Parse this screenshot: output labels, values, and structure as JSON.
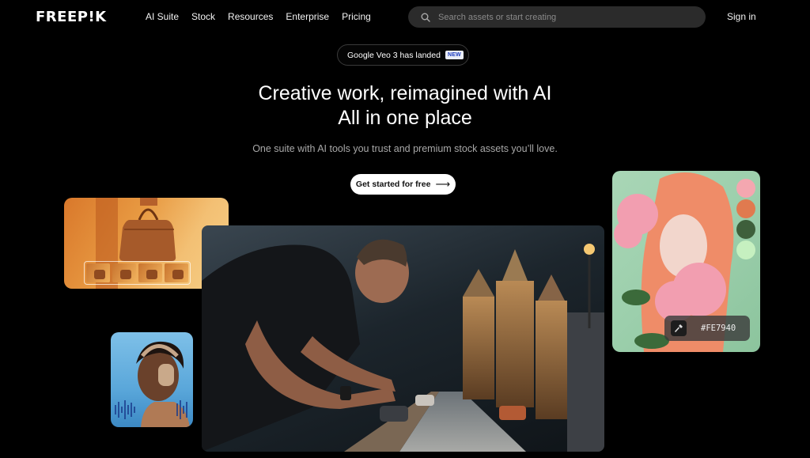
{
  "brand": {
    "logo_text": "FREEP!K"
  },
  "nav": {
    "links": [
      "AI Suite",
      "Stock",
      "Resources",
      "Enterprise",
      "Pricing"
    ],
    "sign_in": "Sign in"
  },
  "search": {
    "placeholder": "Search assets or start creating",
    "icon": "search-icon"
  },
  "announcement": {
    "text": "Google Veo 3 has landed",
    "badge": "NEW"
  },
  "hero": {
    "title_line1": "Creative work, reimagined with AI",
    "title_line2": "All in one place",
    "subtitle": "One suite with AI tools you trust and premium stock assets you’ll love.",
    "cta_label": "Get started for free",
    "cta_icon": "arrow-right-icon"
  },
  "portrait_card": {
    "swatches": [
      "#F4A7B0",
      "#E07A4F",
      "#3E5F3B",
      "#C6F0C0"
    ],
    "picker_hex": "#FE7940",
    "picker_icon": "eyedropper-icon"
  },
  "colors": {
    "background": "#000000",
    "cta_bg": "#FFFFFF",
    "search_bg": "#2B2B2B",
    "badge_text": "#1D3DBF"
  }
}
